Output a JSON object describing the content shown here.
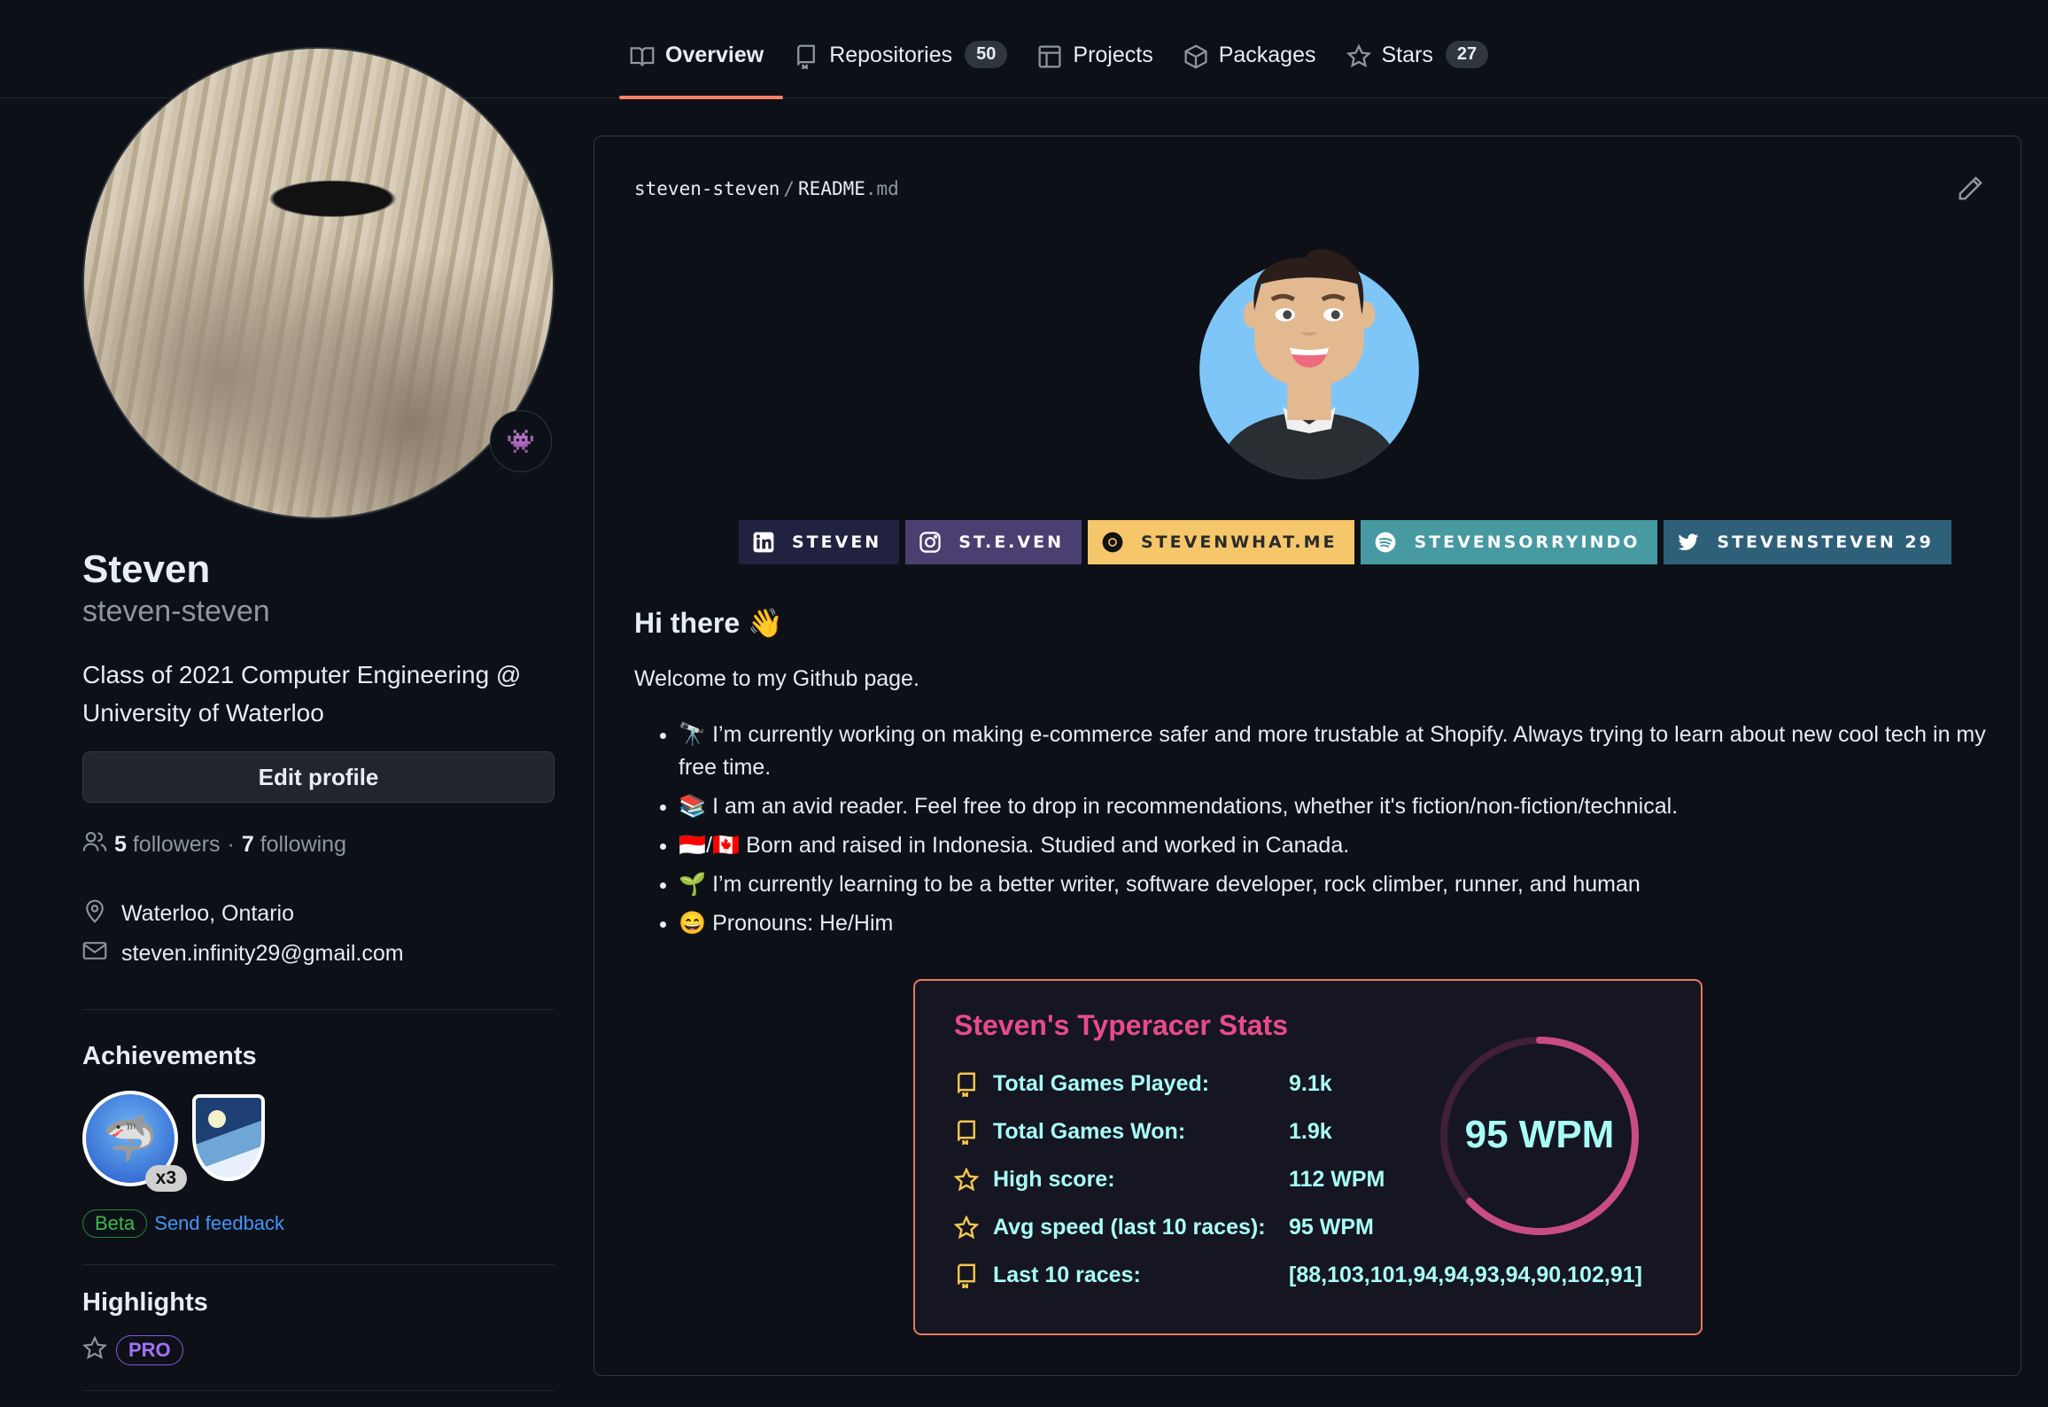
{
  "nav": {
    "tabs": [
      {
        "label": "Overview",
        "icon": "book-icon",
        "active": true
      },
      {
        "label": "Repositories",
        "icon": "repo-icon",
        "count": "50"
      },
      {
        "label": "Projects",
        "icon": "table-icon"
      },
      {
        "label": "Packages",
        "icon": "package-icon"
      },
      {
        "label": "Stars",
        "icon": "star-icon",
        "count": "27"
      }
    ]
  },
  "profile": {
    "status_emoji": "👾",
    "name": "Steven",
    "login": "steven-steven",
    "bio": "Class of 2021 Computer Engineering @ University of Waterloo",
    "edit_label": "Edit profile",
    "followers_count": "5",
    "followers_label": "followers",
    "separator": "·",
    "following_count": "7",
    "following_label": "following",
    "location": "Waterloo, Ontario",
    "email": "steven.infinity29@gmail.com"
  },
  "achievements": {
    "title": "Achievements",
    "items": [
      {
        "name": "Pull Shark",
        "count": "x3"
      },
      {
        "name": "Arctic Code Vault Contributor"
      }
    ],
    "beta_label": "Beta",
    "feedback_label": "Send feedback"
  },
  "highlights": {
    "title": "Highlights",
    "badge": "PRO"
  },
  "readme": {
    "owner": "steven-steven",
    "sep": "/",
    "file_base": "README",
    "file_ext": ".md",
    "badges": [
      {
        "label": "STEVEN",
        "icon": "linkedin-icon",
        "color": "#21223f",
        "text_color": "#ffffff"
      },
      {
        "label": "ST.E.VEN",
        "icon": "instagram-icon",
        "color": "#4b3f72",
        "text_color": "#ffffff"
      },
      {
        "label": "STEVENWHAT.ME",
        "icon": "chrome-icon",
        "color": "#f5c76a",
        "text_color": "#2b2b2b"
      },
      {
        "label": "STEVENSORRYINDO",
        "icon": "spotify-icon",
        "color": "#479aa1",
        "text_color": "#ffffff"
      },
      {
        "label": "STEVENSTEVEN 29",
        "icon": "twitter-icon",
        "color": "#2f607a",
        "text_color": "#ffffff"
      }
    ],
    "heading": "Hi there 👋",
    "welcome": "Welcome to my Github page.",
    "bullets": [
      "🔭 I’m currently working on making e-commerce safer and more trustable at Shopify. Always trying to learn about new cool tech in my free time.",
      "📚 I am an avid reader. Feel free to drop in recommendations, whether it's fiction/non-fiction/technical.",
      "🇮🇩/🇨🇦 Born and raised in Indonesia. Studied and worked in Canada.",
      "🌱 I’m currently learning to be a better writer, software developer, rock climber, runner, and human",
      "😄 Pronouns: He/Him"
    ],
    "stats": {
      "title": "Steven's Typeracer Stats",
      "rows": [
        {
          "icon": "repo-icon",
          "label": "Total Games Played:",
          "value": "9.1k"
        },
        {
          "icon": "repo-icon",
          "label": "Total Games Won:",
          "value": "1.9k"
        },
        {
          "icon": "star-icon",
          "label": "High score:",
          "value": "112 WPM"
        },
        {
          "icon": "star-icon",
          "label": "Avg speed (last 10 races):",
          "value": "95 WPM"
        },
        {
          "icon": "repo-icon",
          "label": "Last 10 races:",
          "value": "[88,103,101,94,94,93,94,90,102,91]"
        }
      ],
      "ring_label": "95 WPM",
      "ring_progress": 0.63,
      "title_color": "#e84b8a",
      "text_color": "#a9fef7",
      "icon_color": "#f3c74e",
      "ring_color": "#c94c82",
      "border_color": "#e8785b"
    }
  }
}
